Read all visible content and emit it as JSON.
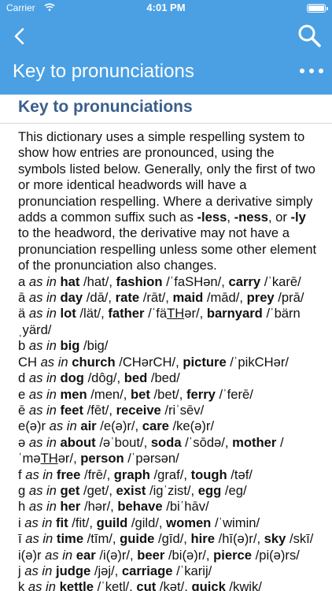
{
  "status_bar": {
    "carrier": "Carrier",
    "time": "4:01 PM"
  },
  "nav": {
    "title": "Key to pronunciations"
  },
  "page": {
    "heading": "Key to pronunciations",
    "intro": [
      {
        "t": "This dictionary uses a simple respelling system to show how entries are pronounced, using the symbols listed below. Generally, only the first of two or more identical headwords will have a pronunciation respelling. Where a derivative simply adds a common suffix such as "
      },
      {
        "t": "-less",
        "b": true
      },
      {
        "t": ", "
      },
      {
        "t": "-ness",
        "b": true
      },
      {
        "t": ", or "
      },
      {
        "t": "-ly",
        "b": true
      },
      {
        "t": " to the headword, the derivative may not have a pronunciation respelling unless some other element of the pronunciation also changes."
      }
    ],
    "entries": [
      [
        {
          "t": "a "
        },
        {
          "t": "as in",
          "i": true
        },
        {
          "t": " "
        },
        {
          "t": "hat",
          "b": true
        },
        {
          "t": " /hat/, "
        },
        {
          "t": "fashion",
          "b": true
        },
        {
          "t": " /ˈfaSHən/, "
        },
        {
          "t": "carry",
          "b": true
        },
        {
          "t": " /ˈkarē/"
        }
      ],
      [
        {
          "t": "ā "
        },
        {
          "t": "as in",
          "i": true
        },
        {
          "t": " "
        },
        {
          "t": "day",
          "b": true
        },
        {
          "t": " /dā/, "
        },
        {
          "t": "rate",
          "b": true
        },
        {
          "t": " /rāt/, "
        },
        {
          "t": "maid",
          "b": true
        },
        {
          "t": " /mād/, "
        },
        {
          "t": "prey",
          "b": true
        },
        {
          "t": " /prā/"
        }
      ],
      [
        {
          "t": "ä "
        },
        {
          "t": "as in",
          "i": true
        },
        {
          "t": " "
        },
        {
          "t": "lot",
          "b": true
        },
        {
          "t": " /lät/, "
        },
        {
          "t": "father",
          "b": true
        },
        {
          "t": " /ˈfä"
        },
        {
          "t": "TH",
          "u": true
        },
        {
          "t": "ər/, "
        },
        {
          "t": "barnyard",
          "b": true
        },
        {
          "t": " /ˈbärnˌyärd/"
        }
      ],
      [
        {
          "t": "b "
        },
        {
          "t": "as in",
          "i": true
        },
        {
          "t": " "
        },
        {
          "t": "big",
          "b": true
        },
        {
          "t": " /big/"
        }
      ],
      [
        {
          "t": "CH "
        },
        {
          "t": "as in",
          "i": true
        },
        {
          "t": " "
        },
        {
          "t": "church",
          "b": true
        },
        {
          "t": " /CHərCH/, "
        },
        {
          "t": "picture",
          "b": true
        },
        {
          "t": " /ˈpikCHər/"
        }
      ],
      [
        {
          "t": "d "
        },
        {
          "t": "as in",
          "i": true
        },
        {
          "t": " "
        },
        {
          "t": "dog",
          "b": true
        },
        {
          "t": " /dôg/, "
        },
        {
          "t": "bed",
          "b": true
        },
        {
          "t": " /bed/"
        }
      ],
      [
        {
          "t": "e "
        },
        {
          "t": "as in",
          "i": true
        },
        {
          "t": " "
        },
        {
          "t": "men",
          "b": true
        },
        {
          "t": " /men/, "
        },
        {
          "t": "bet",
          "b": true
        },
        {
          "t": " /bet/, "
        },
        {
          "t": "ferry",
          "b": true
        },
        {
          "t": " /ˈferē/"
        }
      ],
      [
        {
          "t": "ē "
        },
        {
          "t": "as in",
          "i": true
        },
        {
          "t": " "
        },
        {
          "t": "feet",
          "b": true
        },
        {
          "t": " /fēt/, "
        },
        {
          "t": "receive",
          "b": true
        },
        {
          "t": " /riˈsēv/"
        }
      ],
      [
        {
          "t": "e(ə)r "
        },
        {
          "t": "as in",
          "i": true
        },
        {
          "t": " "
        },
        {
          "t": "air",
          "b": true
        },
        {
          "t": " /e(ə)r/, "
        },
        {
          "t": "care",
          "b": true
        },
        {
          "t": " /ke(ə)r/"
        }
      ],
      [
        {
          "t": "ə "
        },
        {
          "t": "as in",
          "i": true
        },
        {
          "t": " "
        },
        {
          "t": "about",
          "b": true
        },
        {
          "t": " /əˈbout/, "
        },
        {
          "t": "soda",
          "b": true
        },
        {
          "t": " /ˈsōdə/, "
        },
        {
          "t": "mother",
          "b": true
        },
        {
          "t": " /ˈmə"
        },
        {
          "t": "TH",
          "u": true
        },
        {
          "t": "ər/, "
        },
        {
          "t": "person",
          "b": true
        },
        {
          "t": " /ˈpərsən/"
        }
      ],
      [
        {
          "t": "f "
        },
        {
          "t": "as in",
          "i": true
        },
        {
          "t": " "
        },
        {
          "t": "free",
          "b": true
        },
        {
          "t": " /frē/, "
        },
        {
          "t": "graph",
          "b": true
        },
        {
          "t": " /graf/, "
        },
        {
          "t": "tough",
          "b": true
        },
        {
          "t": " /təf/"
        }
      ],
      [
        {
          "t": "g "
        },
        {
          "t": "as in",
          "i": true
        },
        {
          "t": " "
        },
        {
          "t": "get",
          "b": true
        },
        {
          "t": " /get/, "
        },
        {
          "t": "exist",
          "b": true
        },
        {
          "t": " /igˈzist/, "
        },
        {
          "t": "egg",
          "b": true
        },
        {
          "t": " /eg/"
        }
      ],
      [
        {
          "t": "h "
        },
        {
          "t": "as in",
          "i": true
        },
        {
          "t": " "
        },
        {
          "t": "her",
          "b": true
        },
        {
          "t": " /hər/, "
        },
        {
          "t": "behave",
          "b": true
        },
        {
          "t": " /biˈhāv/"
        }
      ],
      [
        {
          "t": "i "
        },
        {
          "t": "as in",
          "i": true
        },
        {
          "t": " "
        },
        {
          "t": "fit",
          "b": true
        },
        {
          "t": " /fit/, "
        },
        {
          "t": "guild",
          "b": true
        },
        {
          "t": " /gild/, "
        },
        {
          "t": "women",
          "b": true
        },
        {
          "t": " /ˈwimin/"
        }
      ],
      [
        {
          "t": "ī "
        },
        {
          "t": "as in",
          "i": true
        },
        {
          "t": " "
        },
        {
          "t": "time",
          "b": true
        },
        {
          "t": " /tīm/, "
        },
        {
          "t": "guide",
          "b": true
        },
        {
          "t": " /gīd/, "
        },
        {
          "t": "hire",
          "b": true
        },
        {
          "t": " /hī(ə)r/, "
        },
        {
          "t": "sky",
          "b": true
        },
        {
          "t": " /skī/"
        }
      ],
      [
        {
          "t": "i(ə)r "
        },
        {
          "t": "as in",
          "i": true
        },
        {
          "t": " "
        },
        {
          "t": "ear",
          "b": true
        },
        {
          "t": " /i(ə)r/, "
        },
        {
          "t": "beer",
          "b": true
        },
        {
          "t": " /bi(ə)r/, "
        },
        {
          "t": "pierce",
          "b": true
        },
        {
          "t": " /pi(ə)rs/"
        }
      ],
      [
        {
          "t": "j "
        },
        {
          "t": "as in",
          "i": true
        },
        {
          "t": " "
        },
        {
          "t": "judge",
          "b": true
        },
        {
          "t": " /jəj/, "
        },
        {
          "t": "carriage",
          "b": true
        },
        {
          "t": " /ˈkarij/"
        }
      ],
      [
        {
          "t": "k "
        },
        {
          "t": "as in",
          "i": true
        },
        {
          "t": " "
        },
        {
          "t": "kettle",
          "b": true
        },
        {
          "t": " /ˈketl/, "
        },
        {
          "t": "cut",
          "b": true
        },
        {
          "t": " /kət/, "
        },
        {
          "t": "quick",
          "b": true
        },
        {
          "t": " /kwik/"
        }
      ]
    ]
  },
  "icons": {
    "back": "chevron-left-icon",
    "search": "search-icon",
    "more": "more-horizontal-icon",
    "wifi": "wifi-icon",
    "battery": "battery-icon"
  },
  "colors": {
    "app_bar": "#4aa0e3",
    "heading": "#3a5f8c",
    "divider": "#d6d6d6"
  }
}
